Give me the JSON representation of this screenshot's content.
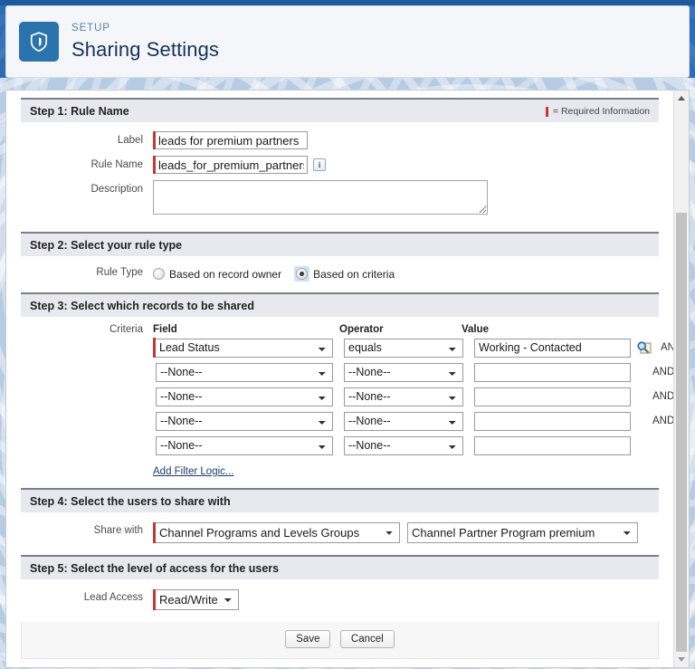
{
  "header": {
    "eyebrow": "SETUP",
    "title": "Sharing Settings",
    "icon": "shield-icon"
  },
  "required_legend": "= Required Information",
  "steps": {
    "step1": {
      "heading": "Step 1: Rule Name",
      "label_field": {
        "label": "Label",
        "value": "leads for premium partners",
        "required": true
      },
      "rule_name_field": {
        "label": "Rule Name",
        "value": "leads_for_premium_partners",
        "required": true,
        "info_icon": "info-icon"
      },
      "description_field": {
        "label": "Description",
        "value": "",
        "required": false
      }
    },
    "step2": {
      "heading": "Step 2: Select your rule type",
      "rule_type_label": "Rule Type",
      "options": [
        {
          "label": "Based on record owner",
          "selected": false
        },
        {
          "label": "Based on criteria",
          "selected": true
        }
      ]
    },
    "step3": {
      "heading": "Step 3: Select which records to be shared",
      "criteria_label": "Criteria",
      "columns": [
        "Field",
        "Operator",
        "Value"
      ],
      "rows": [
        {
          "field": "Lead Status",
          "operator": "equals",
          "value": "Working - Contacted",
          "required": true,
          "lookup": "search-icon",
          "conjunction": "AND"
        },
        {
          "field": "--None--",
          "operator": "--None--",
          "value": "",
          "required": false,
          "conjunction": "AND"
        },
        {
          "field": "--None--",
          "operator": "--None--",
          "value": "",
          "required": false,
          "conjunction": "AND"
        },
        {
          "field": "--None--",
          "operator": "--None--",
          "value": "",
          "required": false,
          "conjunction": "AND"
        },
        {
          "field": "--None--",
          "operator": "--None--",
          "value": "",
          "required": false,
          "conjunction": ""
        }
      ],
      "add_filter_logic": "Add Filter Logic..."
    },
    "step4": {
      "heading": "Step 4: Select the users to share with",
      "share_with_label": "Share with",
      "share_with_category": "Channel Programs and Levels Groups",
      "share_with_target": "Channel Partner Program premium"
    },
    "step5": {
      "heading": "Step 5: Select the level of access for the users",
      "lead_access_label": "Lead Access",
      "lead_access_value": "Read/Write"
    }
  },
  "footer": {
    "save_label": "Save",
    "cancel_label": "Cancel"
  },
  "colors": {
    "accent_blue": "#2a73ad",
    "required_red": "#c23934",
    "section_header_bg": "#e8e8ef",
    "title_navy": "#16325c"
  }
}
